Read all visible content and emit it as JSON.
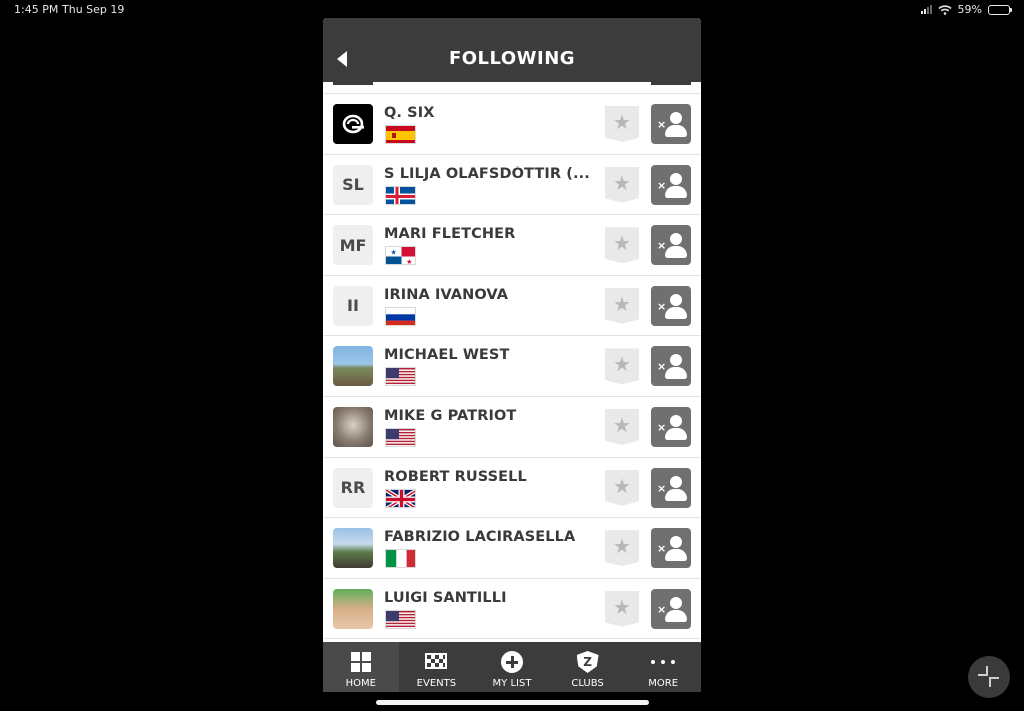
{
  "status_bar": {
    "time": "1:45 PM",
    "date": "Thu Sep 19",
    "battery": "59%",
    "battery_level": 0.59
  },
  "header": {
    "title": "FOLLOWING"
  },
  "following": [
    {
      "name": "Q. SIX",
      "avatar_type": "logo",
      "initials": "",
      "flag": "spain"
    },
    {
      "name": "S LILJA OLAFSDÓTTIR (...",
      "avatar_type": "initials",
      "initials": "SL",
      "flag": "iceland"
    },
    {
      "name": "MARI FLETCHER",
      "avatar_type": "initials",
      "initials": "MF",
      "flag": "panama"
    },
    {
      "name": "IRINA IVANOVA",
      "avatar_type": "initials",
      "initials": "II",
      "flag": "russia"
    },
    {
      "name": "MICHAEL WEST",
      "avatar_type": "photo",
      "initials": "",
      "flag": "usa"
    },
    {
      "name": "MIKE  G PATRIOT",
      "avatar_type": "photo",
      "initials": "",
      "flag": "usa"
    },
    {
      "name": "ROBERT RUSSELL",
      "avatar_type": "initials",
      "initials": "RR",
      "flag": "uk"
    },
    {
      "name": "FABRIZIO LACIRASELLA",
      "avatar_type": "photo",
      "initials": "",
      "flag": "italy"
    },
    {
      "name": "LUIGI SANTILLI",
      "avatar_type": "photo",
      "initials": "",
      "flag": "usa"
    }
  ],
  "tabs": [
    {
      "label": "HOME",
      "icon": "home-grid-icon",
      "active": true
    },
    {
      "label": "EVENTS",
      "icon": "checkered-flag-icon",
      "active": false
    },
    {
      "label": "MY LIST",
      "icon": "plus-circle-icon",
      "active": false
    },
    {
      "label": "CLUBS",
      "icon": "club-shield-icon",
      "active": false
    },
    {
      "label": "MORE",
      "icon": "more-dots-icon",
      "active": false
    }
  ],
  "colors": {
    "header_bg": "#3c3c3c",
    "unfollow_button": "#707070",
    "star_button": "#e9e9e9"
  }
}
